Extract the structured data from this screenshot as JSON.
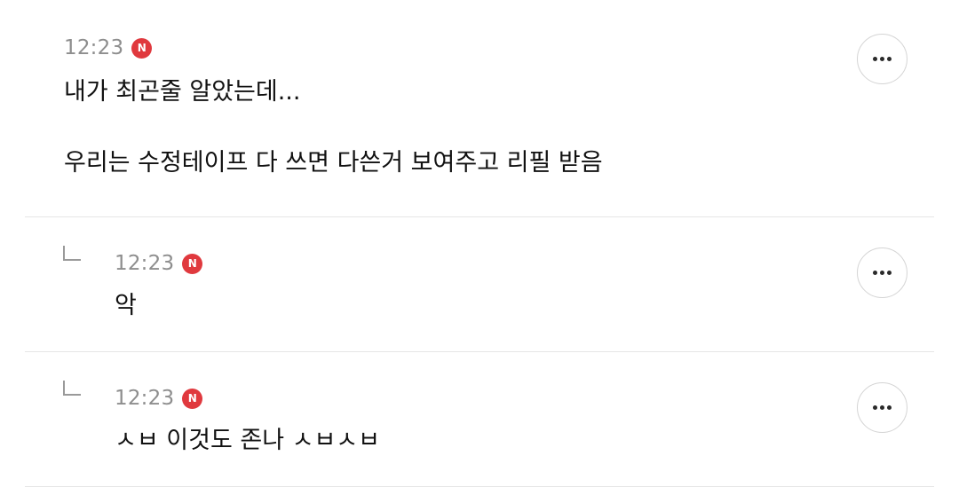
{
  "comments": [
    {
      "time": "12:23",
      "badge": "N",
      "text": "내가 최곤줄 알았는데...\n\n우리는 수정테이프 다 쓰면 다쓴거 보여주고 리필 받음",
      "is_reply": false
    },
    {
      "time": "12:23",
      "badge": "N",
      "text": "악",
      "is_reply": true
    },
    {
      "time": "12:23",
      "badge": "N",
      "text": "ㅅㅂ 이것도 존나 ㅅㅂㅅㅂ",
      "is_reply": true
    }
  ],
  "icons": {
    "new_badge": "new-badge-icon",
    "more": "more-options-icon",
    "reply": "reply-arrow-icon"
  },
  "colors": {
    "badge": "#e0393e",
    "time": "#8e8e8e",
    "text": "#111111",
    "divider": "#e6e6e6"
  }
}
